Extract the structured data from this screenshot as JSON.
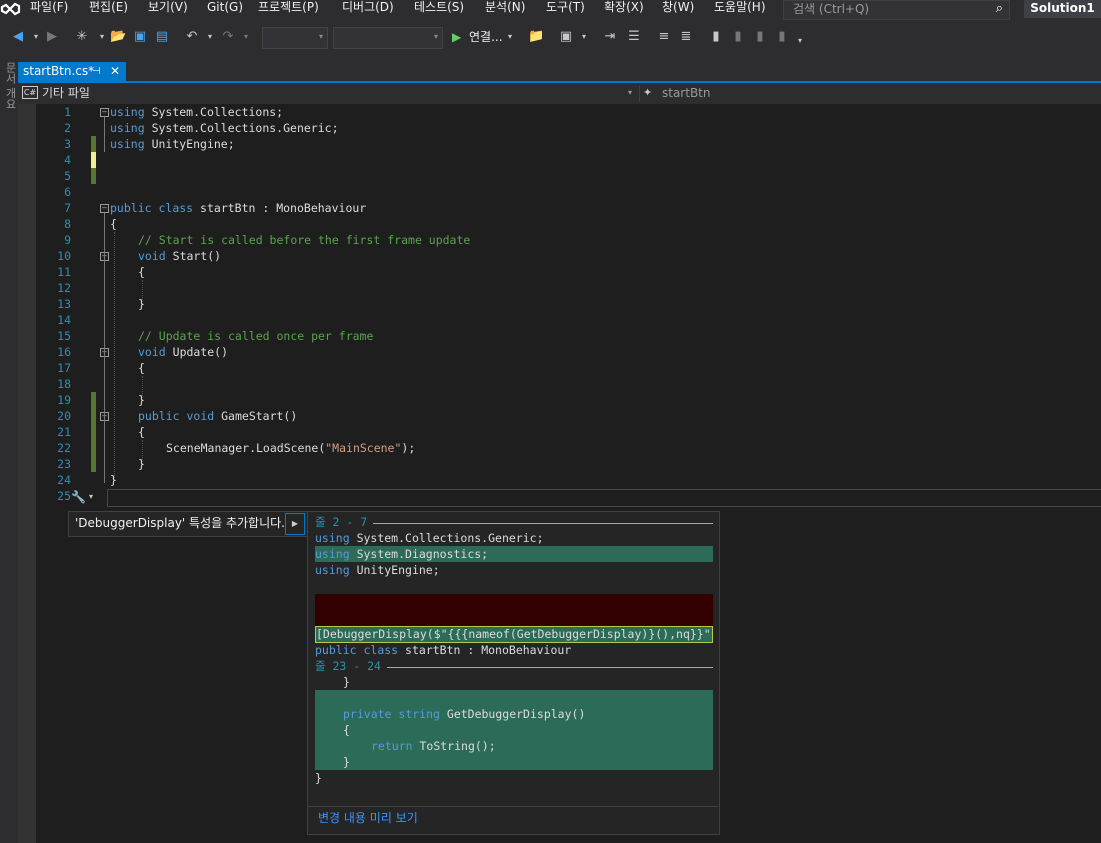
{
  "menubar": {
    "items": [
      "파일(F)",
      "편집(E)",
      "보기(V)",
      "Git(G)",
      "프로젝트(P)",
      "디버그(D)",
      "테스트(S)",
      "분석(N)",
      "도구(T)",
      "확장(X)",
      "창(W)",
      "도움말(H)"
    ],
    "search_placeholder": "검색 (Ctrl+Q)",
    "solution_name": "Solution1"
  },
  "toolbar": {
    "run_label": "연결..."
  },
  "side_tab_label": "문서 개요",
  "tab": {
    "title": "startBtn.cs*"
  },
  "navbar": {
    "cs_badge": "C#",
    "project": "기타 파일",
    "member": "startBtn"
  },
  "colors": {
    "accent": "#007acc",
    "keyword": "#569cd6",
    "comment": "#57a64a",
    "string": "#d69d85",
    "line_number": "#2b91af",
    "change_marker_saved": "#577430",
    "change_marker_unsaved": "#efef8f",
    "preview_added": "#2b6b57",
    "preview_removed": "#320000"
  },
  "editor": {
    "line_numbers": [
      "1",
      "2",
      "3",
      "4",
      "5",
      "6",
      "7",
      "8",
      "9",
      "10",
      "11",
      "12",
      "13",
      "14",
      "15",
      "16",
      "17",
      "18",
      "19",
      "20",
      "21",
      "22",
      "23",
      "24",
      "25"
    ],
    "lines": {
      "l1": "System.Collections;",
      "l2": "System.Collections.Generic;",
      "l3": "UnityEngine;",
      "l7_cls": "startBtn",
      "l7_rest": " : MonoBehaviour",
      "l8": "{",
      "l9": "// Start is called before the first frame update",
      "l10": "Start()",
      "l11": "{",
      "l13": "}",
      "l15": "// Update is called once per frame",
      "l16": "Update()",
      "l17": "{",
      "l19": "}",
      "l20": "GameStart()",
      "l21": "{",
      "l22a": "SceneManager.LoadScene(",
      "l22s": "\"MainScene\"",
      "l22b": ");",
      "l23": "}",
      "l24": "}"
    },
    "kw": {
      "using": "using",
      "public": "public",
      "class": "class",
      "void": "void",
      "private": "private",
      "string": "string",
      "return": "return"
    }
  },
  "quick_action": {
    "label": "'DebuggerDisplay' 특성을 추가합니다."
  },
  "preview": {
    "header1": "줄 2 - 7",
    "p1": "System.Collections.Generic;",
    "p2": "System.Diagnostics;",
    "p3": "UnityEngine;",
    "p4": "[DebuggerDisplay($\"{{{nameof(GetDebuggerDisplay)}(),nq}}\"",
    "p5_cls": "startBtn",
    "p5_rest": " : MonoBehaviour",
    "header2": "줄 23 - 24",
    "p6": "}",
    "p7": "GetDebuggerDisplay()",
    "p8": "{",
    "p9": "ToString();",
    "p10": "}",
    "p11": "}",
    "link": "변경 내용 미리 보기"
  }
}
